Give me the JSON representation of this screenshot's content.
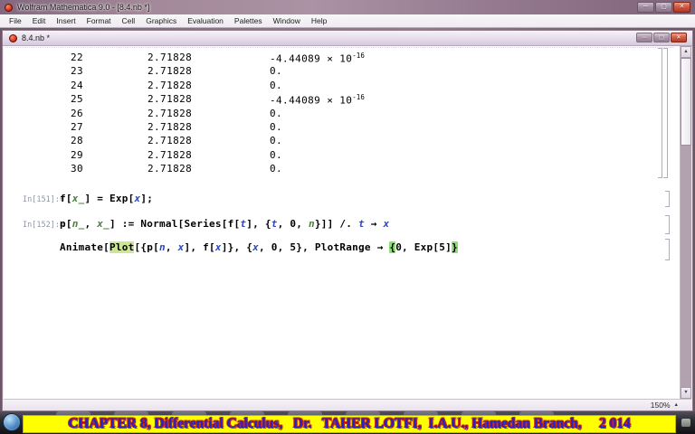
{
  "app": {
    "title": "Wolfram Mathematica 9.0 - [8.4.nb *]",
    "menu": [
      "File",
      "Edit",
      "Insert",
      "Format",
      "Cell",
      "Graphics",
      "Evaluation",
      "Palettes",
      "Window",
      "Help"
    ],
    "icons": {
      "minimize": "─",
      "maximize": "▢",
      "close": "✕",
      "scroll_up": "▲",
      "scroll_down": "▼",
      "zoom_arrow": "▲"
    }
  },
  "notebook": {
    "title": "8.4.nb *",
    "zoom_level": "150%",
    "output_table": {
      "rows": [
        {
          "n": "22",
          "value": "2.71828",
          "err": "-4.44089 × 10",
          "err_exp": "-16"
        },
        {
          "n": "23",
          "value": "2.71828",
          "err": "0.",
          "err_exp": ""
        },
        {
          "n": "24",
          "value": "2.71828",
          "err": "0.",
          "err_exp": ""
        },
        {
          "n": "25",
          "value": "2.71828",
          "err": "-4.44089 × 10",
          "err_exp": "-16"
        },
        {
          "n": "26",
          "value": "2.71828",
          "err": "0.",
          "err_exp": ""
        },
        {
          "n": "27",
          "value": "2.71828",
          "err": "0.",
          "err_exp": ""
        },
        {
          "n": "28",
          "value": "2.71828",
          "err": "0.",
          "err_exp": ""
        },
        {
          "n": "29",
          "value": "2.71828",
          "err": "0.",
          "err_exp": ""
        },
        {
          "n": "30",
          "value": "2.71828",
          "err": "0.",
          "err_exp": ""
        }
      ]
    },
    "cells": [
      {
        "label": "In[151]:=",
        "segments": [
          {
            "t": "f[",
            "c": "k"
          },
          {
            "t": "x_",
            "c": "p"
          },
          {
            "t": "] = Exp[",
            "c": "k"
          },
          {
            "t": "x",
            "c": "s"
          },
          {
            "t": "];",
            "c": "k"
          }
        ]
      },
      {
        "label": "In[152]:=",
        "segments": [
          {
            "t": "p[",
            "c": "k"
          },
          {
            "t": "n_",
            "c": "p"
          },
          {
            "t": ", ",
            "c": "k"
          },
          {
            "t": "x_",
            "c": "p"
          },
          {
            "t": "] := Normal[Series[f[",
            "c": "k"
          },
          {
            "t": "t",
            "c": "s"
          },
          {
            "t": "], {",
            "c": "k"
          },
          {
            "t": "t",
            "c": "s"
          },
          {
            "t": ", 0, ",
            "c": "k"
          },
          {
            "t": "n",
            "c": "p"
          },
          {
            "t": "}]] /. ",
            "c": "k"
          },
          {
            "t": "t",
            "c": "s"
          },
          {
            "t": " → ",
            "c": "k"
          },
          {
            "t": "x",
            "c": "s"
          }
        ]
      },
      {
        "label": "",
        "segments": [
          {
            "t": "Animate[",
            "c": "k"
          },
          {
            "t": "Plot",
            "c": "hl"
          },
          {
            "t": "[{p[",
            "c": "k"
          },
          {
            "t": "n",
            "c": "s"
          },
          {
            "t": ", ",
            "c": "k"
          },
          {
            "t": "x",
            "c": "s"
          },
          {
            "t": "], f[",
            "c": "k"
          },
          {
            "t": "x",
            "c": "s"
          },
          {
            "t": "]}, {",
            "c": "k"
          },
          {
            "t": "x",
            "c": "s"
          },
          {
            "t": ", 0, 5}, PlotRange → ",
            "c": "k"
          },
          {
            "t": "{",
            "c": "hb"
          },
          {
            "t": "0, Exp[5]",
            "c": "k"
          },
          {
            "t": "}",
            "c": "hb"
          }
        ]
      }
    ]
  },
  "taskbar": {
    "banner": "CHAPTER 8, Differential Calculus,   Dr.   TAHER LOTFI,  I.A.U., Hamedan Branch,     2 014"
  },
  "colors": {
    "banner_bg": "#ffff00",
    "banner_text": "#2424cc",
    "banner_outline": "#cc2200",
    "close_button_red": "#c84b38",
    "pattern_green": "#4f7f3c",
    "symbol_blue": "#2e48c0",
    "plot_highlight": "#cbe793",
    "brace_highlight": "#8edd78",
    "titlebar_purple": "#967b90"
  }
}
